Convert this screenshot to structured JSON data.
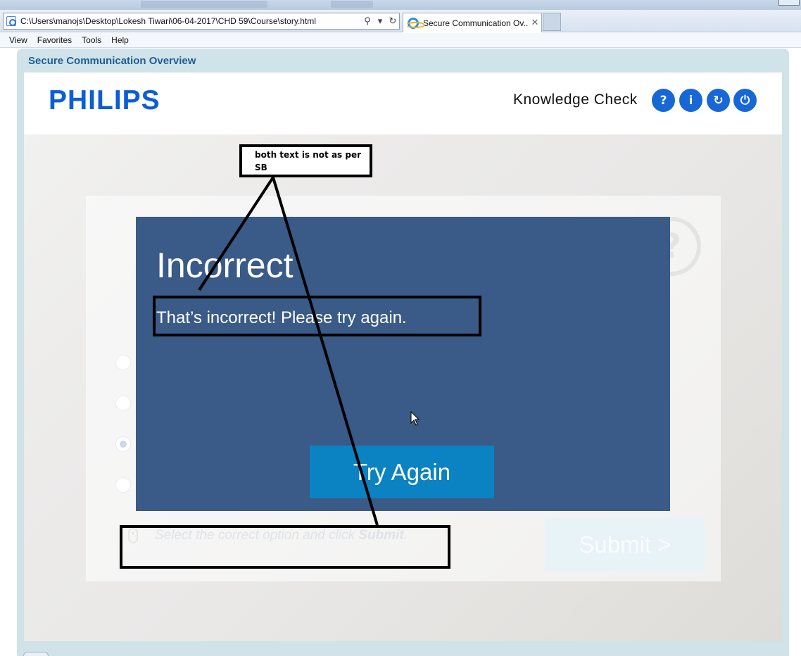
{
  "browser": {
    "address_url": "C:\\Users\\manojs\\Desktop\\Lokesh Tiwari\\06-04-2017\\CHD 59\\Course\\story.html",
    "search_icon": "search-icon",
    "dropdown_icon": "chevron-down-icon",
    "refresh_icon": "refresh-icon",
    "search_glyph": "⚲",
    "dropdown_glyph": "▾",
    "refresh_glyph": "↻",
    "tab_title": "Secure Communication Ov...",
    "tab_close": "✕"
  },
  "menu": {
    "items": [
      "View",
      "Favorites",
      "Tools",
      "Help"
    ]
  },
  "player": {
    "title": "Secure Communication Overview",
    "logo": "PHILIPS",
    "section_label": "Knowledge Check",
    "buttons": [
      {
        "icon": "question-icon",
        "glyph": "?"
      },
      {
        "icon": "info-icon",
        "glyph": "i"
      },
      {
        "icon": "replay-icon",
        "glyph": "↻"
      },
      {
        "icon": "power-icon",
        "glyph": "⏻"
      }
    ],
    "accent_color": "#1767d6"
  },
  "question": {
    "instruction_prefix": "Select the correct option and click ",
    "instruction_bold": "Submit",
    "instruction_suffix": ".",
    "submit_label": "Submit  >"
  },
  "feedback": {
    "title": "Incorrect",
    "message": "That’s incorrect! Please try again.",
    "button_label": "Try Again",
    "background_color": "#3a5a87",
    "button_color": "#0b82c2"
  },
  "annotation": {
    "note": "both text is not as per SB"
  }
}
